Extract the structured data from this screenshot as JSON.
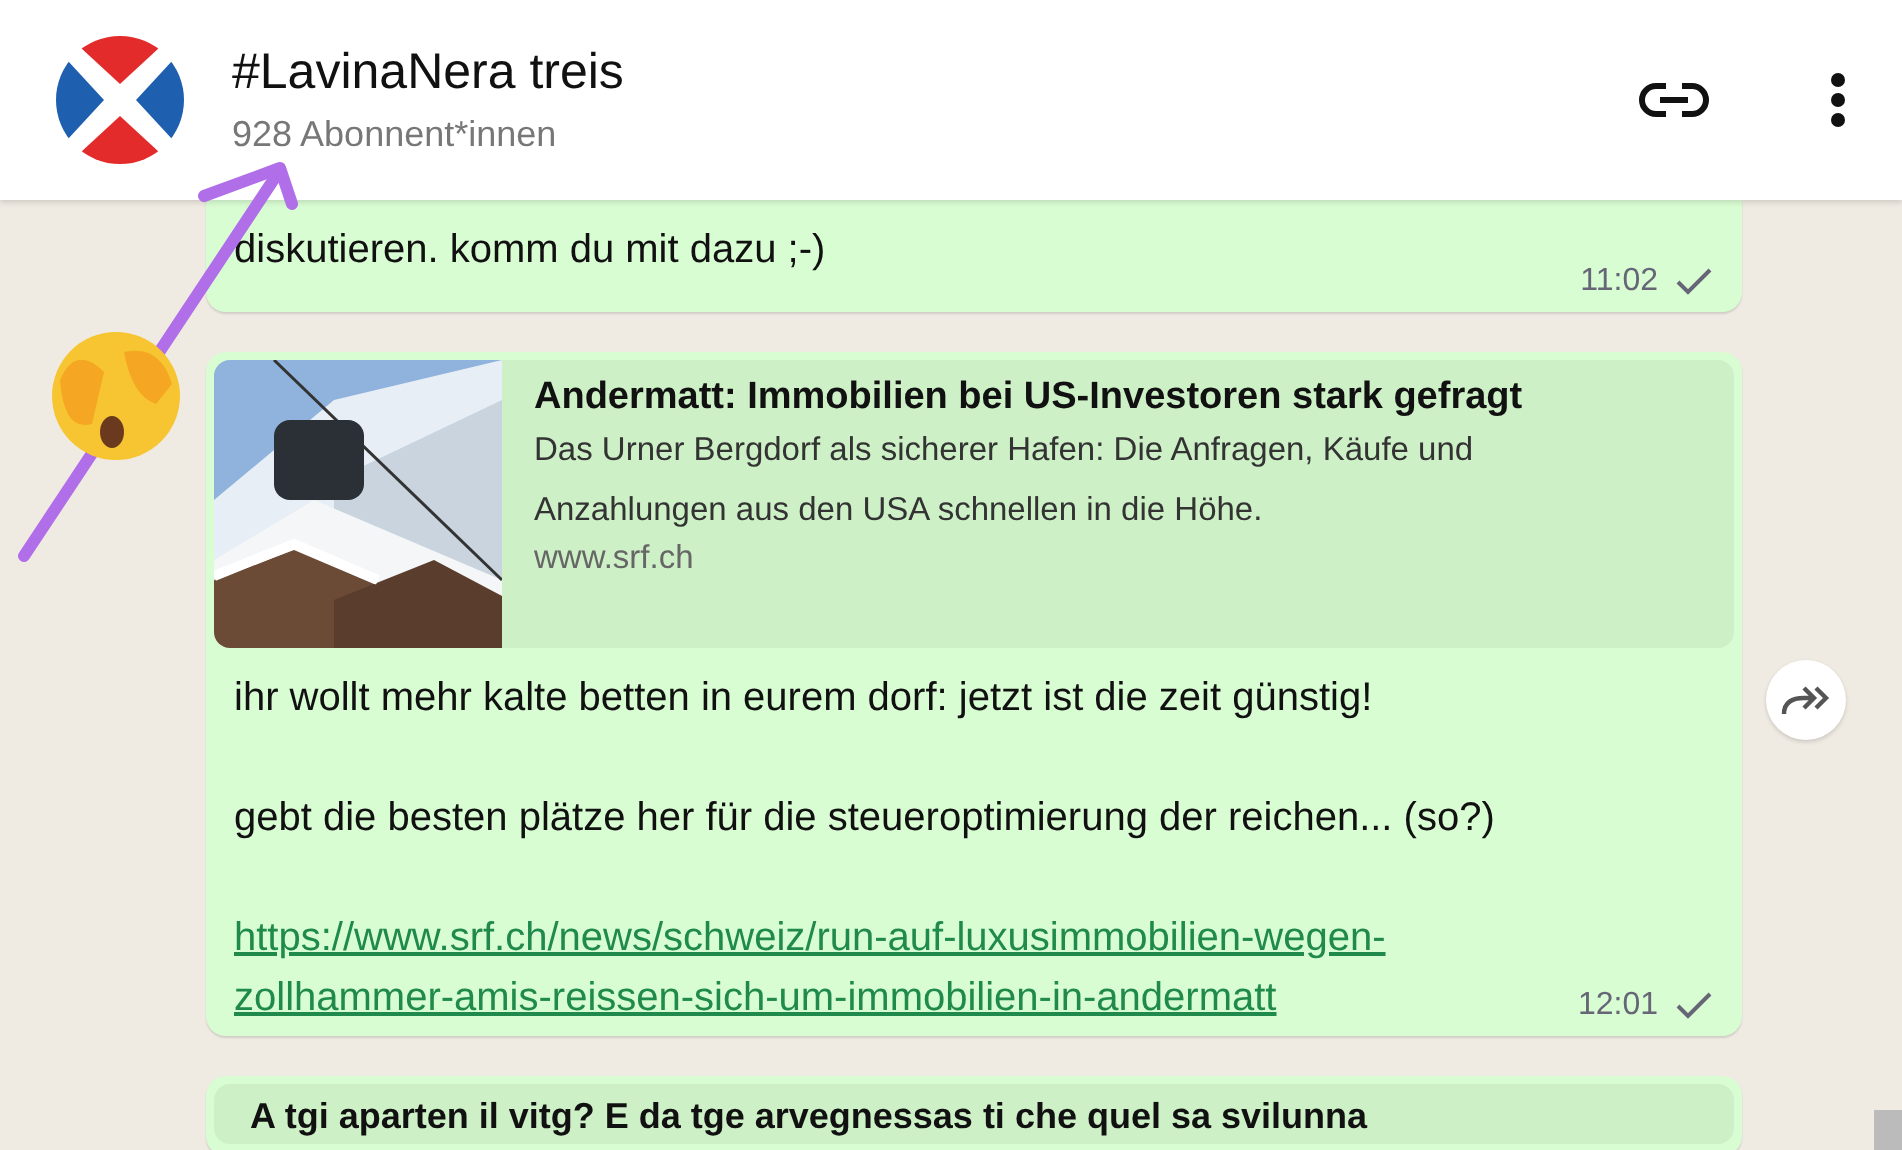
{
  "header": {
    "title": "#LavinaNera treis",
    "subtitle": "928 Abonnent*innen"
  },
  "messages": [
    {
      "kind": "text",
      "paragraphs": [
        "diskutieren. komm du mit dazu ;-)"
      ],
      "time": "11:02",
      "sent": true
    },
    {
      "kind": "preview",
      "preview": {
        "title": "Andermatt: Immobilien bei US-Investoren stark gefragt",
        "description": "Das Urner Bergdorf als sicherer Hafen: Die Anfragen, Käufe und Anzahlungen aus den USA schnellen in die Höhe.",
        "domain": "www.srf.ch"
      },
      "paragraphs": [
        "ihr wollt mehr kalte betten in eurem dorf: jetzt ist die zeit günstig!",
        "gebt die besten plätze her für die steueroptimierung der reichen... (so?)"
      ],
      "link": "https://www.srf.ch/news/schweiz/run-auf-luxusimmobilien-wegen-zollhammer-amis-reissen-sich-um-immobilien-in-andermatt",
      "time": "12:01",
      "sent": true
    },
    {
      "kind": "quote",
      "quote": "A tgi aparten il vitg? E da tge arvegnessas ti che quel sa svilunna"
    }
  ]
}
